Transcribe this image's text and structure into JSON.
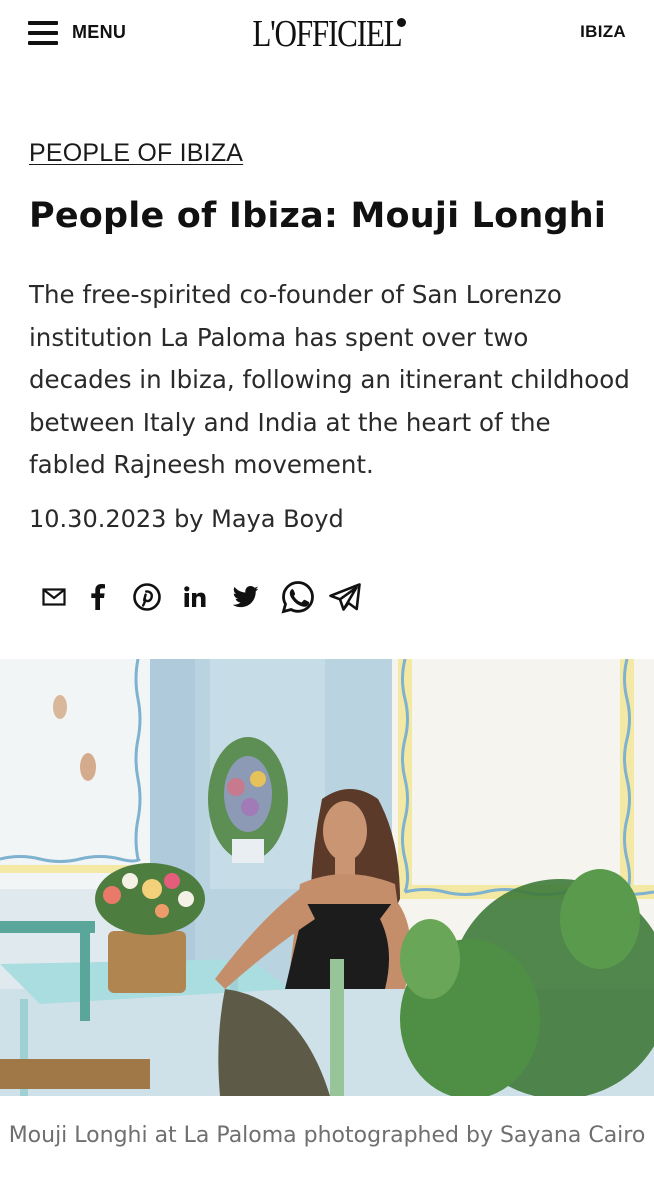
{
  "header": {
    "menu_label": "MENU",
    "logo_text": "L'OFFICIEL",
    "region_label": "IBIZA"
  },
  "article": {
    "category": "PEOPLE OF IBIZA",
    "title": "People of Ibiza: Mouji Longhi",
    "dek": "The free-spirited co-founder of San Lorenzo institution La Paloma has spent over two decades in Ibiza, following an itinerant childhood between Italy and India at the heart of the fabled Rajneesh movement.",
    "date": "10.30.2023",
    "byline_prefix": "by",
    "author": "Maya Boyd"
  },
  "share": {
    "icons": [
      "mail-icon",
      "facebook-icon",
      "pinterest-icon",
      "linkedin-icon",
      "twitter-icon",
      "whatsapp-icon",
      "telegram-icon"
    ]
  },
  "photo": {
    "caption": "Mouji Longhi at La Paloma photographed by Sayana Cairo"
  },
  "colors": {
    "text": "#1a1a1a",
    "caption": "#6f6f6f",
    "wall": "#b9d3e0",
    "wall_light": "#dfe9ee",
    "border_yellow": "#f3e9a4",
    "plant_green": "#3f7a3a"
  }
}
